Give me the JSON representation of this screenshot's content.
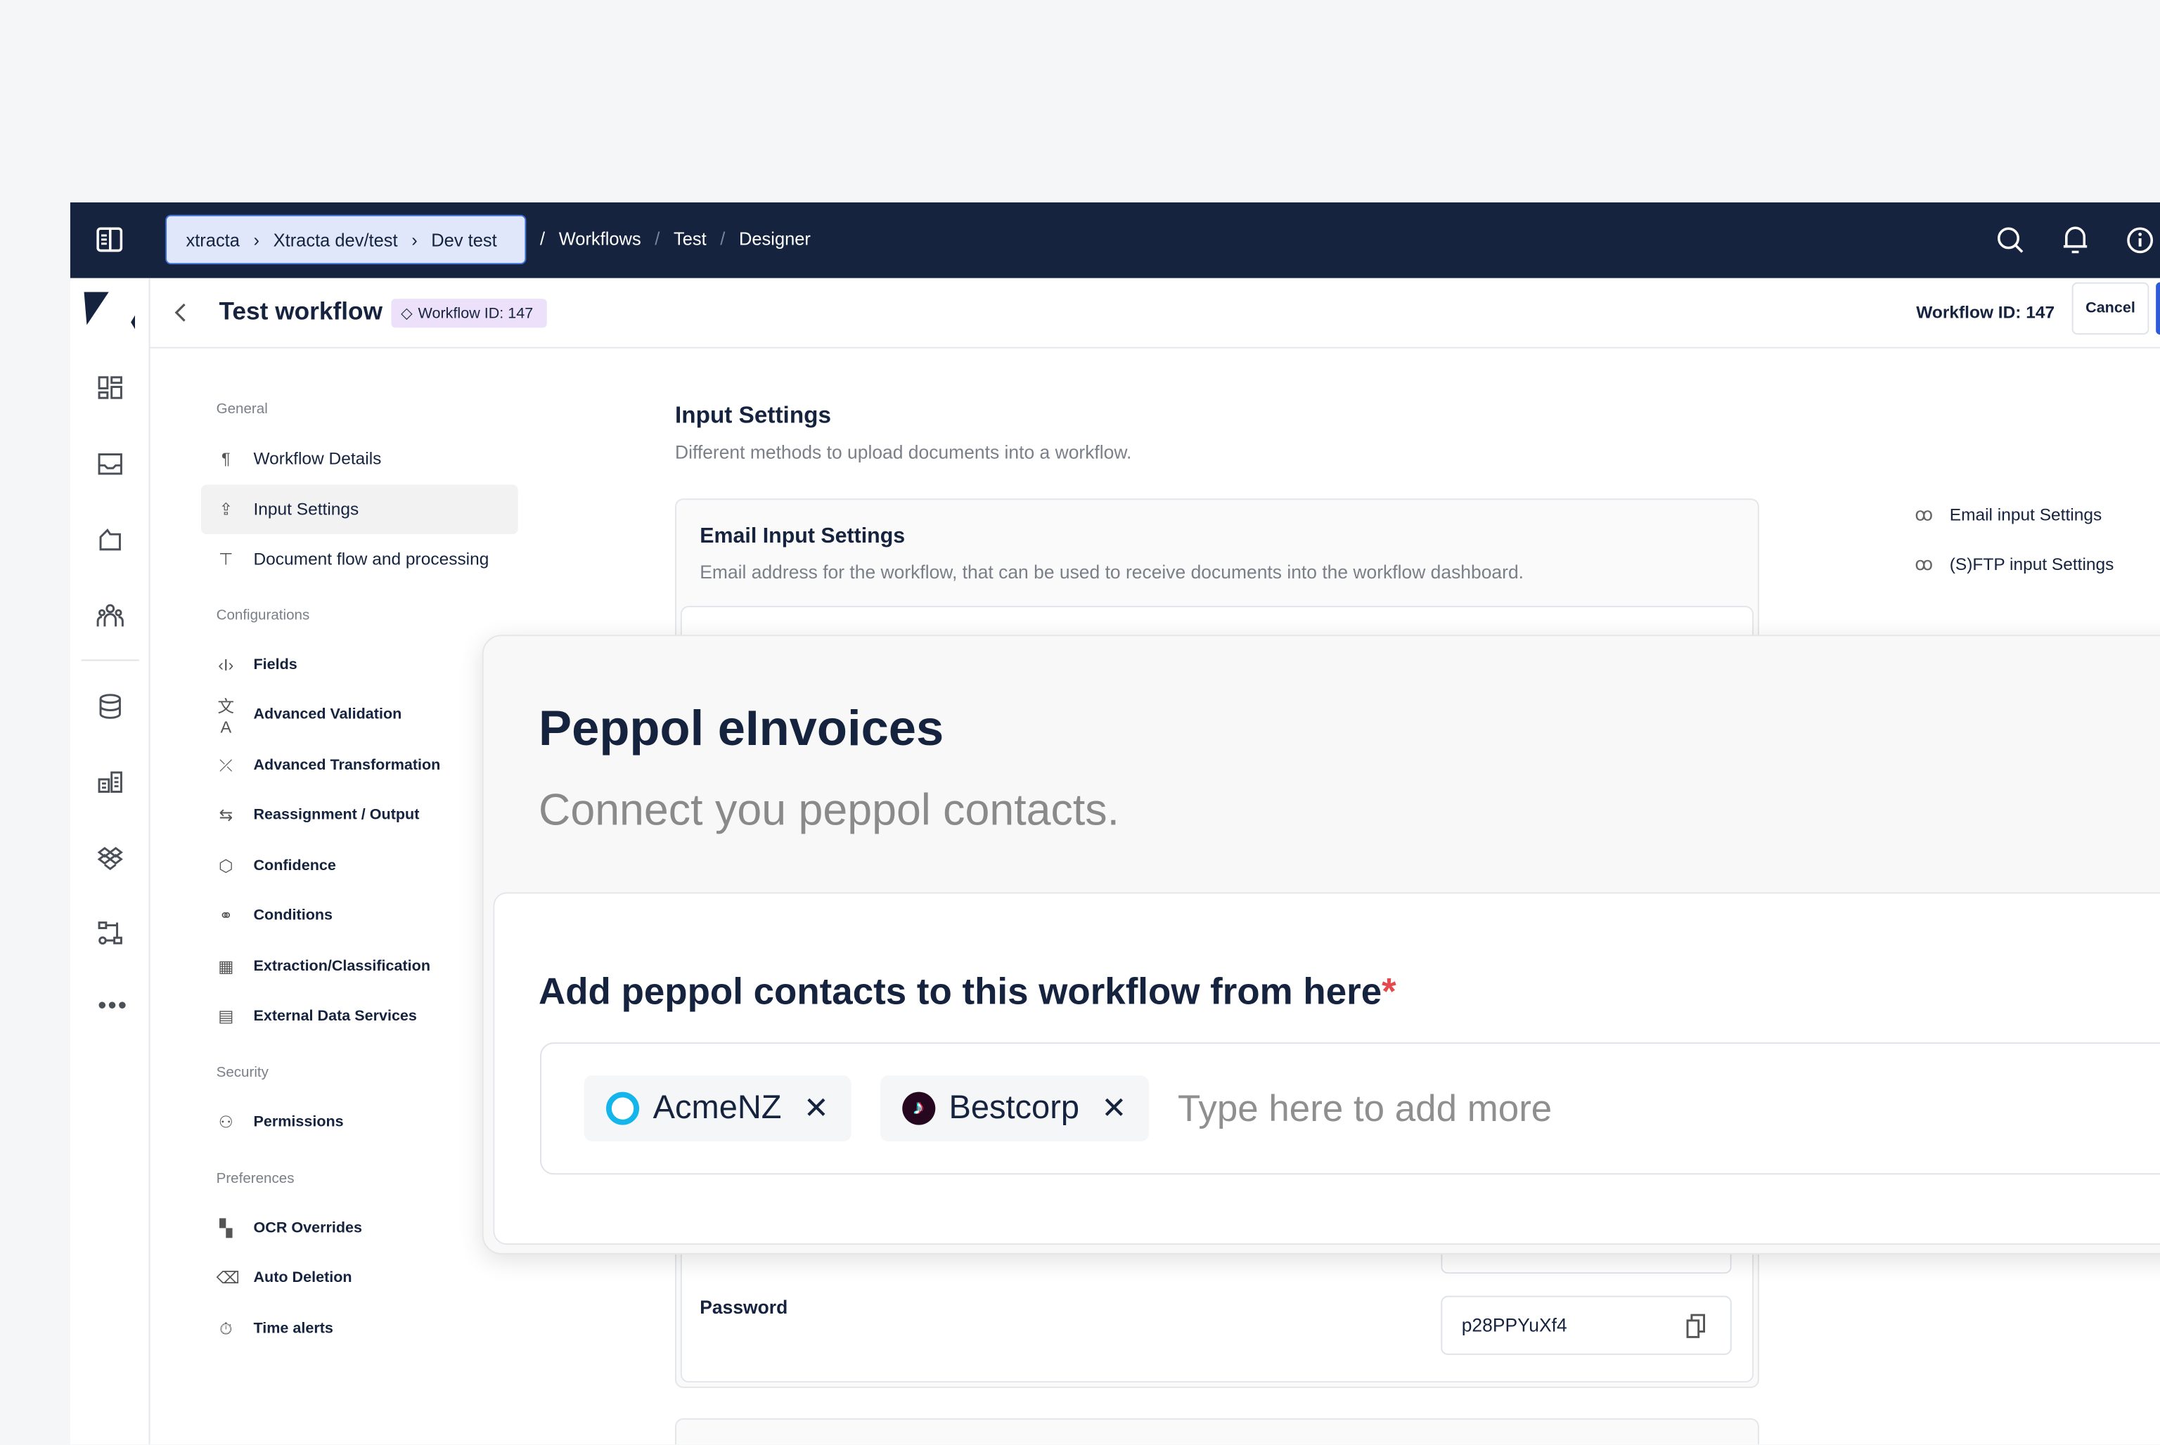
{
  "topbar": {
    "org_breadcrumb": [
      "xtracta",
      "Xtracta dev/test",
      "Dev test"
    ],
    "path_breadcrumb": [
      "Workflows",
      "Test",
      "Designer"
    ],
    "icons": [
      "sidebar-toggle-icon",
      "search-icon",
      "bell-icon",
      "info-icon"
    ]
  },
  "header": {
    "title": "Test workflow",
    "badge": "Workflow ID: 147",
    "workflow_id": "Workflow ID: 147",
    "cancel": "Cancel"
  },
  "settings_nav": {
    "sections": [
      {
        "label": "General",
        "items": [
          {
            "label": "Workflow Details",
            "icon": "¶"
          },
          {
            "label": "Input Settings",
            "icon": "⇪",
            "active": true
          },
          {
            "label": "Document flow and processing",
            "icon": "⊤"
          }
        ]
      },
      {
        "label": "Configurations",
        "items": [
          {
            "label": "Fields",
            "icon": "‹I›"
          },
          {
            "label": "Advanced Validation",
            "icon": "文A"
          },
          {
            "label": "Advanced Transformation",
            "icon": "⤫"
          },
          {
            "label": "Reassignment / Output",
            "icon": "⇆"
          },
          {
            "label": "Confidence",
            "icon": "⬡"
          },
          {
            "label": "Conditions",
            "icon": "⚭"
          },
          {
            "label": "Extraction/Classification",
            "icon": "▦"
          },
          {
            "label": "External Data Services",
            "icon": "▤"
          }
        ]
      },
      {
        "label": "Security",
        "items": [
          {
            "label": "Permissions",
            "icon": "⚇"
          }
        ]
      },
      {
        "label": "Preferences",
        "items": [
          {
            "label": "OCR Overrides",
            "icon": "▚"
          },
          {
            "label": "Auto Deletion",
            "icon": "⌫"
          },
          {
            "label": "Time alerts",
            "icon": "⏱"
          }
        ]
      }
    ]
  },
  "content": {
    "title": "Input Settings",
    "subtitle": "Different methods to upload documents into a workflow.",
    "email_card": {
      "title": "Email Input Settings",
      "description": "Email address for the workflow, that can be used to receive documents into the workflow dashboard."
    },
    "password_label": "Password",
    "password_value": "p28PPYuXf4",
    "anchors": [
      "Email input Settings",
      "(S)FTP input Settings"
    ]
  },
  "modal": {
    "title": "Peppol eInvoices",
    "subtitle": "Connect you peppol contacts.",
    "field_label": "Add peppol contacts to this workflow from here",
    "required_mark": "*",
    "chips": [
      {
        "label": "AcmeNZ",
        "logo_color": "#13b5ea"
      },
      {
        "label": "Bestcorp",
        "logo_color": "#25081f"
      }
    ],
    "remove_glyph": "✕",
    "placeholder": "Type here to add more"
  },
  "colors": {
    "navbar": "#15233f",
    "accent": "#2f5bd8",
    "badge": "#ede0fb",
    "required": "#e5484d"
  }
}
